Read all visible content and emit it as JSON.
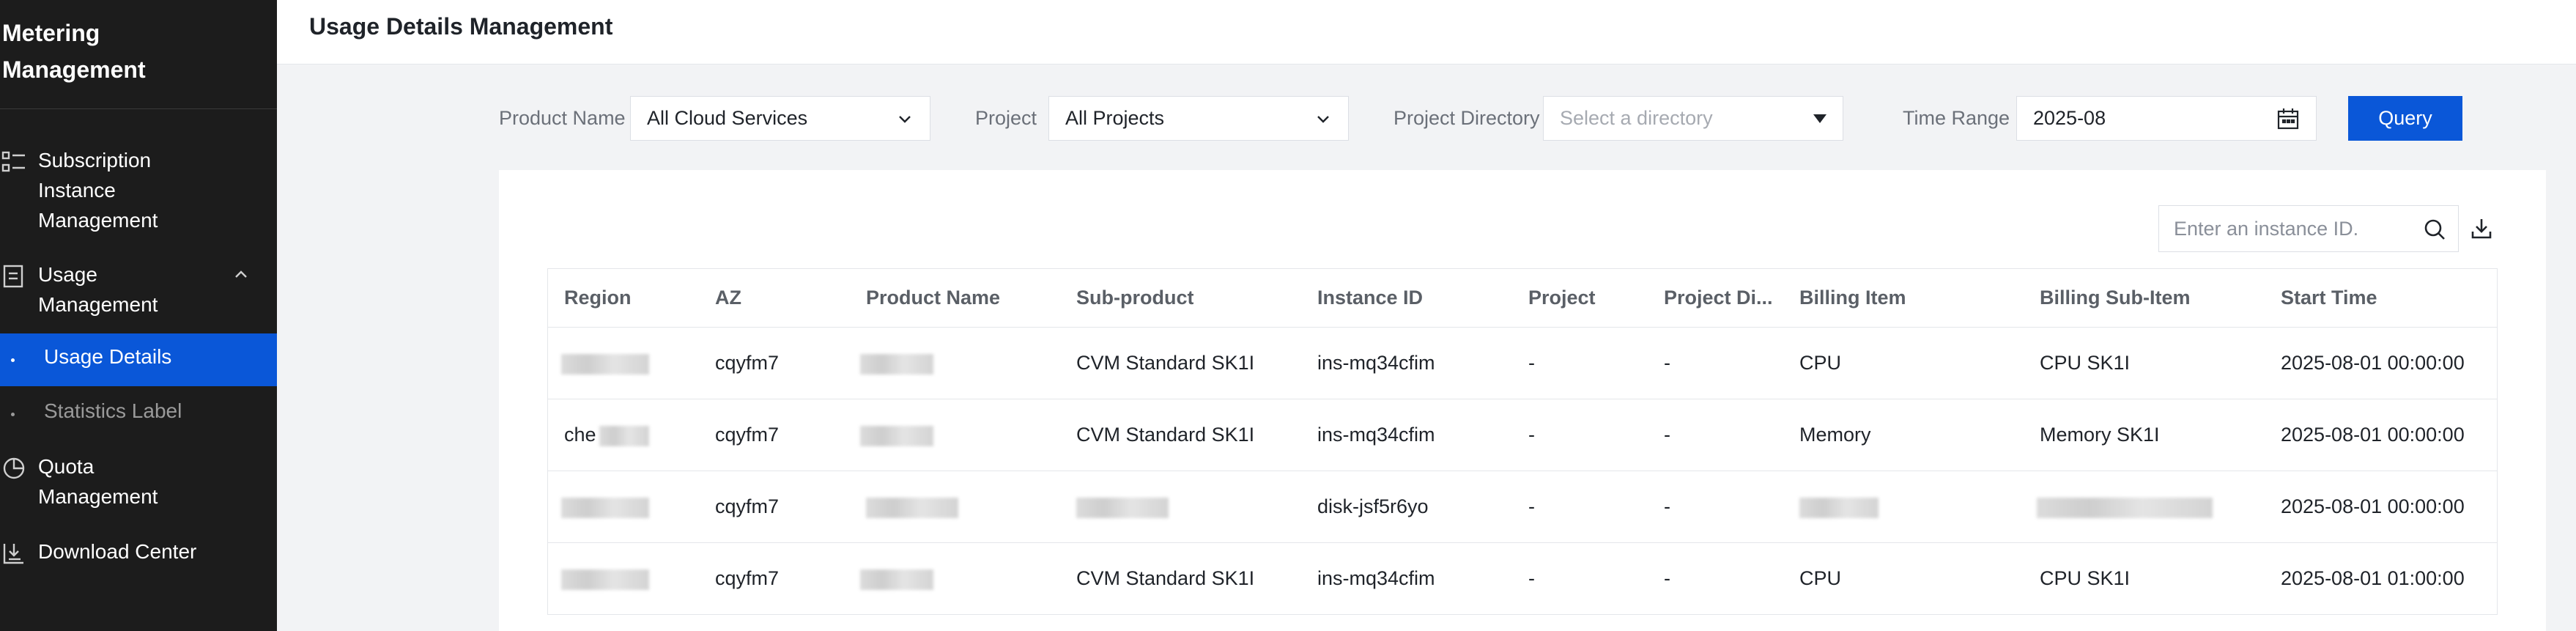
{
  "sidebar": {
    "title": "Metering Management",
    "items": [
      {
        "label": "Subscription Instance Management",
        "icon": "list-icon"
      },
      {
        "label": "Usage Management",
        "icon": "document-icon",
        "expanded": true,
        "children": [
          {
            "label": "Usage Details",
            "active": true
          },
          {
            "label": "Statistics Label",
            "active": false
          }
        ]
      },
      {
        "label": "Quota Management",
        "icon": "pie-chart-icon"
      },
      {
        "label": "Download Center",
        "icon": "download-box-icon"
      }
    ]
  },
  "header": {
    "title": "Usage Details Management"
  },
  "filters": {
    "product_name": {
      "label": "Product Name",
      "value": "All Cloud Services"
    },
    "project": {
      "label": "Project",
      "value": "All Projects"
    },
    "project_directory": {
      "label": "Project Directory",
      "placeholder": "Select a directory"
    },
    "time_range": {
      "label": "Time Range",
      "value": "2025-08"
    },
    "query_label": "Query"
  },
  "search": {
    "placeholder": "Enter an instance ID."
  },
  "table": {
    "columns": [
      "Region",
      "AZ",
      "Product Name",
      "Sub-product",
      "Instance ID",
      "Project",
      "Project Di...",
      "Billing Item",
      "Billing Sub-Item",
      "Start Time"
    ],
    "rows": [
      {
        "region": "",
        "az": "cqyfm7",
        "product": "",
        "sub_product": "CVM Standard SK1I",
        "instance_id": "ins-mq34cfim",
        "project": "-",
        "project_dir": "-",
        "billing_item": "CPU",
        "billing_sub_item": "CPU SK1I",
        "start_time": "2025-08-01 00:00:00"
      },
      {
        "region": "che",
        "az": "cqyfm7",
        "product": "",
        "sub_product": "CVM Standard SK1I",
        "instance_id": "ins-mq34cfim",
        "project": "-",
        "project_dir": "-",
        "billing_item": "Memory",
        "billing_sub_item": "Memory SK1I",
        "start_time": "2025-08-01 00:00:00"
      },
      {
        "region": "",
        "az": "cqyfm7",
        "product": "",
        "sub_product": "",
        "instance_id": "disk-jsf5r6yo",
        "project": "-",
        "project_dir": "-",
        "billing_item": "",
        "billing_sub_item": "",
        "start_time": "2025-08-01 00:00:00"
      },
      {
        "region": "",
        "az": "cqyfm7",
        "product": "",
        "sub_product": "CVM Standard SK1I",
        "instance_id": "ins-mq34cfim",
        "project": "-",
        "project_dir": "-",
        "billing_item": "CPU",
        "billing_sub_item": "CPU SK1I",
        "start_time": "2025-08-01 01:00:00"
      }
    ]
  },
  "colors": {
    "accent": "#0a57d8",
    "sidebar_bg": "#1c1c1c",
    "page_bg": "#f2f3f5"
  }
}
